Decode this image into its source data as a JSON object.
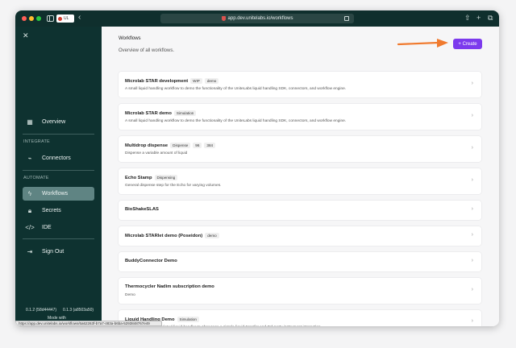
{
  "browser": {
    "profile_label": "UL",
    "url": "app.dev.unitelabs.io/workflows",
    "status_url": "https://app.dev.unitelabs.io/workflows/6a62263f-b7a7-483a-b6ba-5293848767e49"
  },
  "sidebar": {
    "nav_overview": "Overview",
    "section_integrate": "INTEGRATE",
    "nav_connectors": "Connectors",
    "section_automate": "AUTOMATE",
    "nav_workflows": "Workflows",
    "nav_secrets": "Secrets",
    "nav_ide": "IDE",
    "nav_signout": "Sign Out",
    "version_left": "0.1.2 (58d44447)",
    "version_right": "0.1.3 (a8503a50)",
    "mode_label": "Mode with"
  },
  "main": {
    "title": "Workflows",
    "subtitle": "Overview of all workflows.",
    "create_label": "+ Create",
    "workflows": [
      {
        "title": "Microlab STAR development",
        "tags": [
          "WIP",
          "demo"
        ],
        "desc": "A small liquid handling workflow to demo the functionality of the UniteLabs liquid handling SDK, connectors, and workflow engine."
      },
      {
        "title": "Microlab STAR demo",
        "tags": [
          "Simulation"
        ],
        "desc": "A small liquid handling workflow to demo the functionality of the UniteLabs liquid handling SDK, connectors, and workflow engine."
      },
      {
        "title": "Multidrop dispense",
        "tags": [
          "Dispense",
          "96",
          "384"
        ],
        "desc": "Dispense a variable amount of liquid"
      },
      {
        "title": "Echo Stamp",
        "tags": [
          "Dispensing"
        ],
        "desc": "General dispense step for the Echo for varying volumes."
      },
      {
        "title": "BioShakeSLAS",
        "tags": [],
        "desc": ""
      },
      {
        "title": "Microlab STARlet demo (Poseidon)",
        "tags": [
          "demo"
        ],
        "desc": ""
      },
      {
        "title": "BuddyConnector Demo",
        "tags": [],
        "desc": ""
      },
      {
        "title": "Thermocycler Nadim subscription demo",
        "tags": [],
        "desc": "Demo"
      },
      {
        "title": "Liquid Handling Demo",
        "tags": [
          "Simulation"
        ],
        "desc": "A workflow with a simulated liquid handler to showcase a simple liquid transfer and 3rd party instrument interaction."
      }
    ]
  },
  "colors": {
    "sidebar_bg": "#0e3230",
    "active_nav": "#5f8483",
    "create_button": "#7c3aed",
    "arrow": "#f07a2e"
  }
}
